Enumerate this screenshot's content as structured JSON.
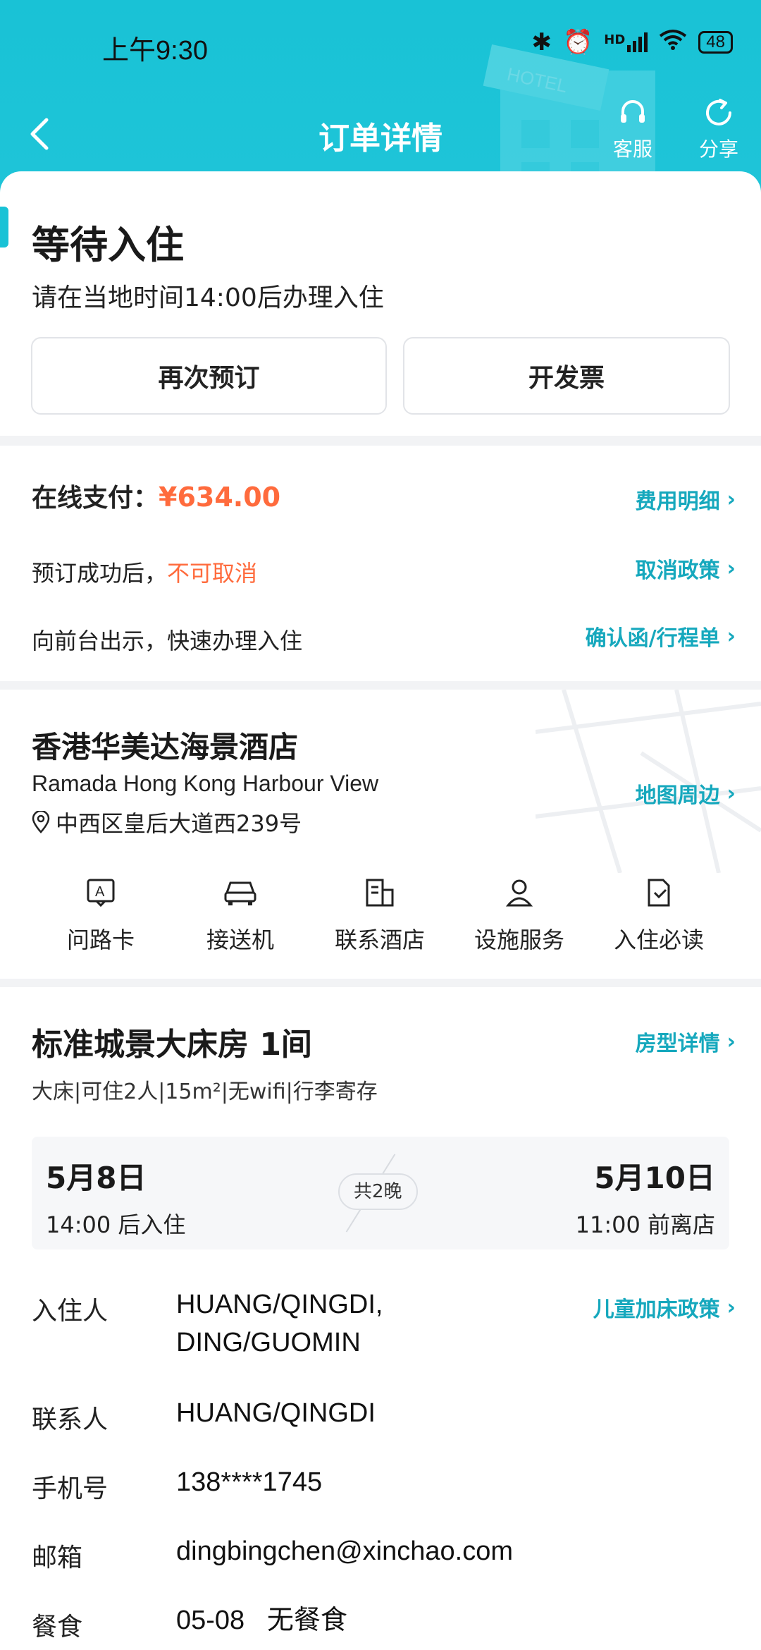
{
  "status_bar": {
    "time": "上午9:30",
    "network": "HD",
    "battery": "48"
  },
  "nav": {
    "title": "订单详情",
    "service_label": "客服",
    "share_label": "分享",
    "hotel_sign": "HOTEL"
  },
  "status": {
    "title": "等待入住",
    "subtitle": "请在当地时间14:00后办理入住",
    "rebook_label": "再次预订",
    "invoice_label": "开发票"
  },
  "payment": {
    "label": "在线支付：",
    "amount": "¥634.00",
    "fee_link": "费用明细",
    "cancel_prefix": "预订成功后，",
    "cancel_status": "不可取消",
    "cancel_link": "取消政策",
    "frontdesk_label": "向前台出示，快速办理入住",
    "confirm_link": "确认函/行程单"
  },
  "hotel": {
    "name": "香港华美达海景酒店",
    "name_en": "Ramada Hong Kong Harbour View",
    "address": "中西区皇后大道西239号",
    "map_link": "地图周边",
    "services": [
      {
        "label": "问路卡",
        "icon": "direction-card-icon"
      },
      {
        "label": "接送机",
        "icon": "car-icon"
      },
      {
        "label": "联系酒店",
        "icon": "contact-hotel-icon"
      },
      {
        "label": "设施服务",
        "icon": "facility-icon"
      },
      {
        "label": "入住必读",
        "icon": "notice-icon"
      }
    ]
  },
  "room": {
    "title": "标准城景大床房 1间",
    "detail_link": "房型详情",
    "features": "大床|可住2人|15m²|无wifi|行李寄存",
    "checkin_date": "5月8日",
    "checkin_time": "14:00 后入住",
    "checkout_date": "5月10日",
    "checkout_time": "11:00 前离店",
    "nights": "共2晚"
  },
  "info": {
    "guest_label": "入住人",
    "guest_line1": "HUANG/QINGDI,",
    "guest_line2": "DING/GUOMIN",
    "child_policy_link": "儿童加床政策",
    "contact_label": "联系人",
    "contact_value": "HUANG/QINGDI",
    "phone_label": "手机号",
    "phone_value": "138****1745",
    "email_label": "邮箱",
    "email_value": "dingbingchen@xinchao.com",
    "meal_label": "餐食",
    "meal_value": "05-08   无餐食"
  },
  "colors": {
    "accent": "#19c2d6",
    "link": "#16a8bd",
    "price": "#ff6b3d"
  }
}
